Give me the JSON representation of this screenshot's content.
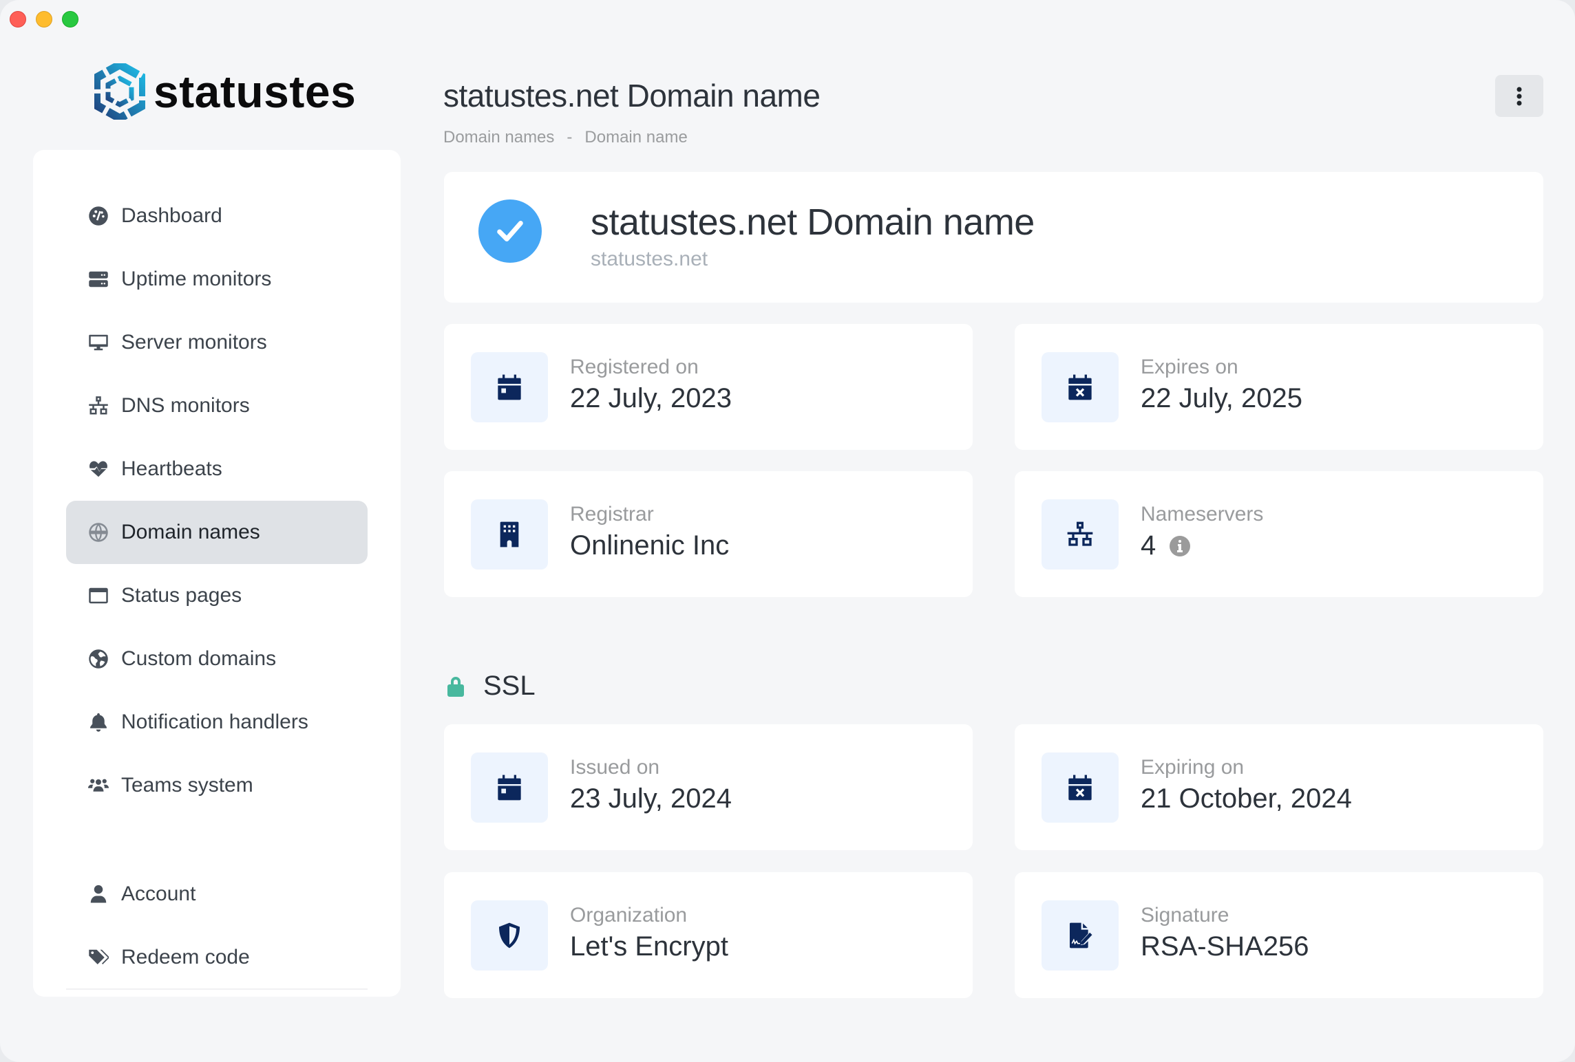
{
  "app": {
    "brand": "statustes",
    "brand_colors": {
      "logo_dark": "#1f3e7a",
      "logo_light": "#1fc0ea"
    }
  },
  "sidebar": {
    "items": [
      {
        "label": "Dashboard",
        "icon": "dashboard-gauge-icon",
        "active": false
      },
      {
        "label": "Uptime monitors",
        "icon": "server-icon",
        "active": false
      },
      {
        "label": "Server monitors",
        "icon": "desktop-icon",
        "active": false
      },
      {
        "label": "DNS monitors",
        "icon": "network-icon",
        "active": false
      },
      {
        "label": "Heartbeats",
        "icon": "heart-pulse-icon",
        "active": false
      },
      {
        "label": "Domain names",
        "icon": "globe-icon",
        "active": true
      },
      {
        "label": "Status pages",
        "icon": "window-icon",
        "active": false
      },
      {
        "label": "Custom domains",
        "icon": "earth-icon",
        "active": false
      },
      {
        "label": "Notification handlers",
        "icon": "bell-icon",
        "active": false
      },
      {
        "label": "Teams system",
        "icon": "users-icon",
        "active": false
      }
    ],
    "secondary_items": [
      {
        "label": "Account",
        "icon": "user-icon"
      },
      {
        "label": "Redeem code",
        "icon": "tags-icon"
      }
    ]
  },
  "header": {
    "title": "statustes.net Domain name",
    "breadcrumb": [
      "Domain names",
      "Domain name"
    ],
    "breadcrumb_separator": "-",
    "more_icon": "ellipsis-vertical-icon"
  },
  "hero": {
    "title": "statustes.net Domain name",
    "subtitle": "statustes.net",
    "status_icon": "check-circle-icon",
    "status_color": "#46a7f5"
  },
  "domain_info": [
    {
      "label": "Registered on",
      "value": "22 July, 2023",
      "icon": "calendar-icon"
    },
    {
      "label": "Expires on",
      "value": "22 July, 2025",
      "icon": "calendar-x-icon"
    },
    {
      "label": "Registrar",
      "value": "Onlinenic Inc",
      "icon": "building-icon"
    },
    {
      "label": "Nameservers",
      "value": "4",
      "icon": "network-icon",
      "has_info": true
    }
  ],
  "ssl": {
    "title": "SSL",
    "icon": "lock-icon",
    "icon_color": "#48b89e",
    "items": [
      {
        "label": "Issued on",
        "value": "23 July, 2024",
        "icon": "calendar-icon"
      },
      {
        "label": "Expiring on",
        "value": "21 October, 2024",
        "icon": "calendar-x-icon"
      },
      {
        "label": "Organization",
        "value": "Let's Encrypt",
        "icon": "shield-icon"
      },
      {
        "label": "Signature",
        "value": "RSA-SHA256",
        "icon": "file-signature-icon"
      }
    ]
  }
}
